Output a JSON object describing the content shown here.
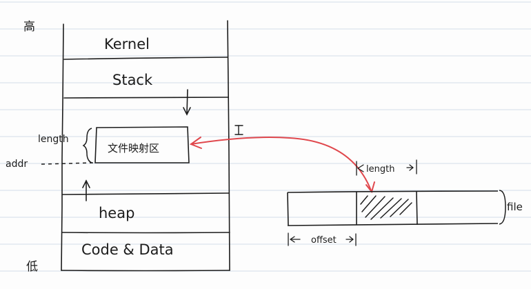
{
  "labels": {
    "high_addr": "高",
    "low_addr": "低",
    "kernel": "Kernel",
    "stack": "Stack",
    "mmap_region": "文件映射区",
    "heap": "heap",
    "code_data": "Code & Data",
    "length_left": "length",
    "addr": "addr",
    "length_file": "length",
    "offset": "offset",
    "file": "file",
    "cursor": "I"
  },
  "colors": {
    "ink": "#1c1c1c",
    "mapping_arrow": "#e0474c",
    "ruled_line": "#d3dde9",
    "paper": "#fdfdfd"
  },
  "icons": {
    "stack_growth": "arrow-down-icon",
    "heap_growth": "arrow-up-icon",
    "cursor": "text-cursor-icon"
  }
}
